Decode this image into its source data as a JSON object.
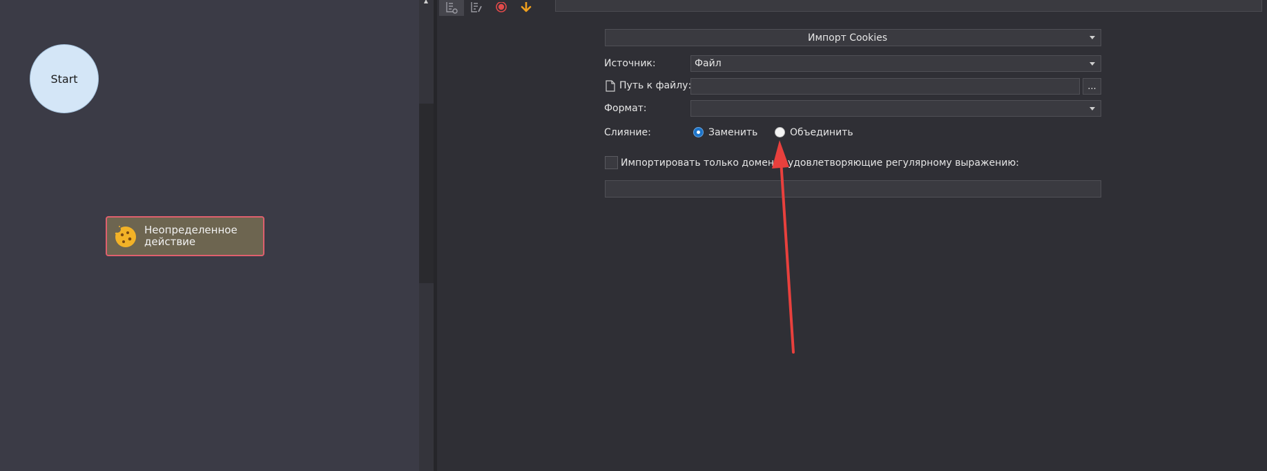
{
  "canvas": {
    "start_node": {
      "label": "Start"
    },
    "action_node": {
      "label_line1": "Неопределенное",
      "label_line2": "действие",
      "icon": "cookie-icon"
    }
  },
  "toolbar": {
    "buttons": [
      {
        "icon": "list-settings-icon"
      },
      {
        "icon": "list-edit-icon"
      },
      {
        "icon": "record-icon"
      },
      {
        "icon": "arrow-down-icon"
      }
    ]
  },
  "form": {
    "action_select": {
      "value": "Импорт Cookies"
    },
    "source": {
      "label": "Источник:",
      "value": "Файл"
    },
    "file_path": {
      "label": "Путь к файлу:",
      "value": "",
      "browse_label": "...",
      "icon": "file-icon"
    },
    "format": {
      "label": "Формат:",
      "value": ""
    },
    "merge": {
      "label": "Слияние:",
      "options": [
        {
          "label": "Заменить",
          "selected": true
        },
        {
          "label": "Объединить",
          "selected": false
        }
      ]
    },
    "domain_filter": {
      "label": "Импортировать только домены, удовлетворяющие регулярному выражению:",
      "checked": false,
      "value": ""
    }
  },
  "colors": {
    "canvas_bg": "#3b3b46",
    "panel_bg": "#2f2f35",
    "accent_blue": "#1d74c9",
    "annotation_red": "#e8403d",
    "action_border": "#e0606e"
  }
}
